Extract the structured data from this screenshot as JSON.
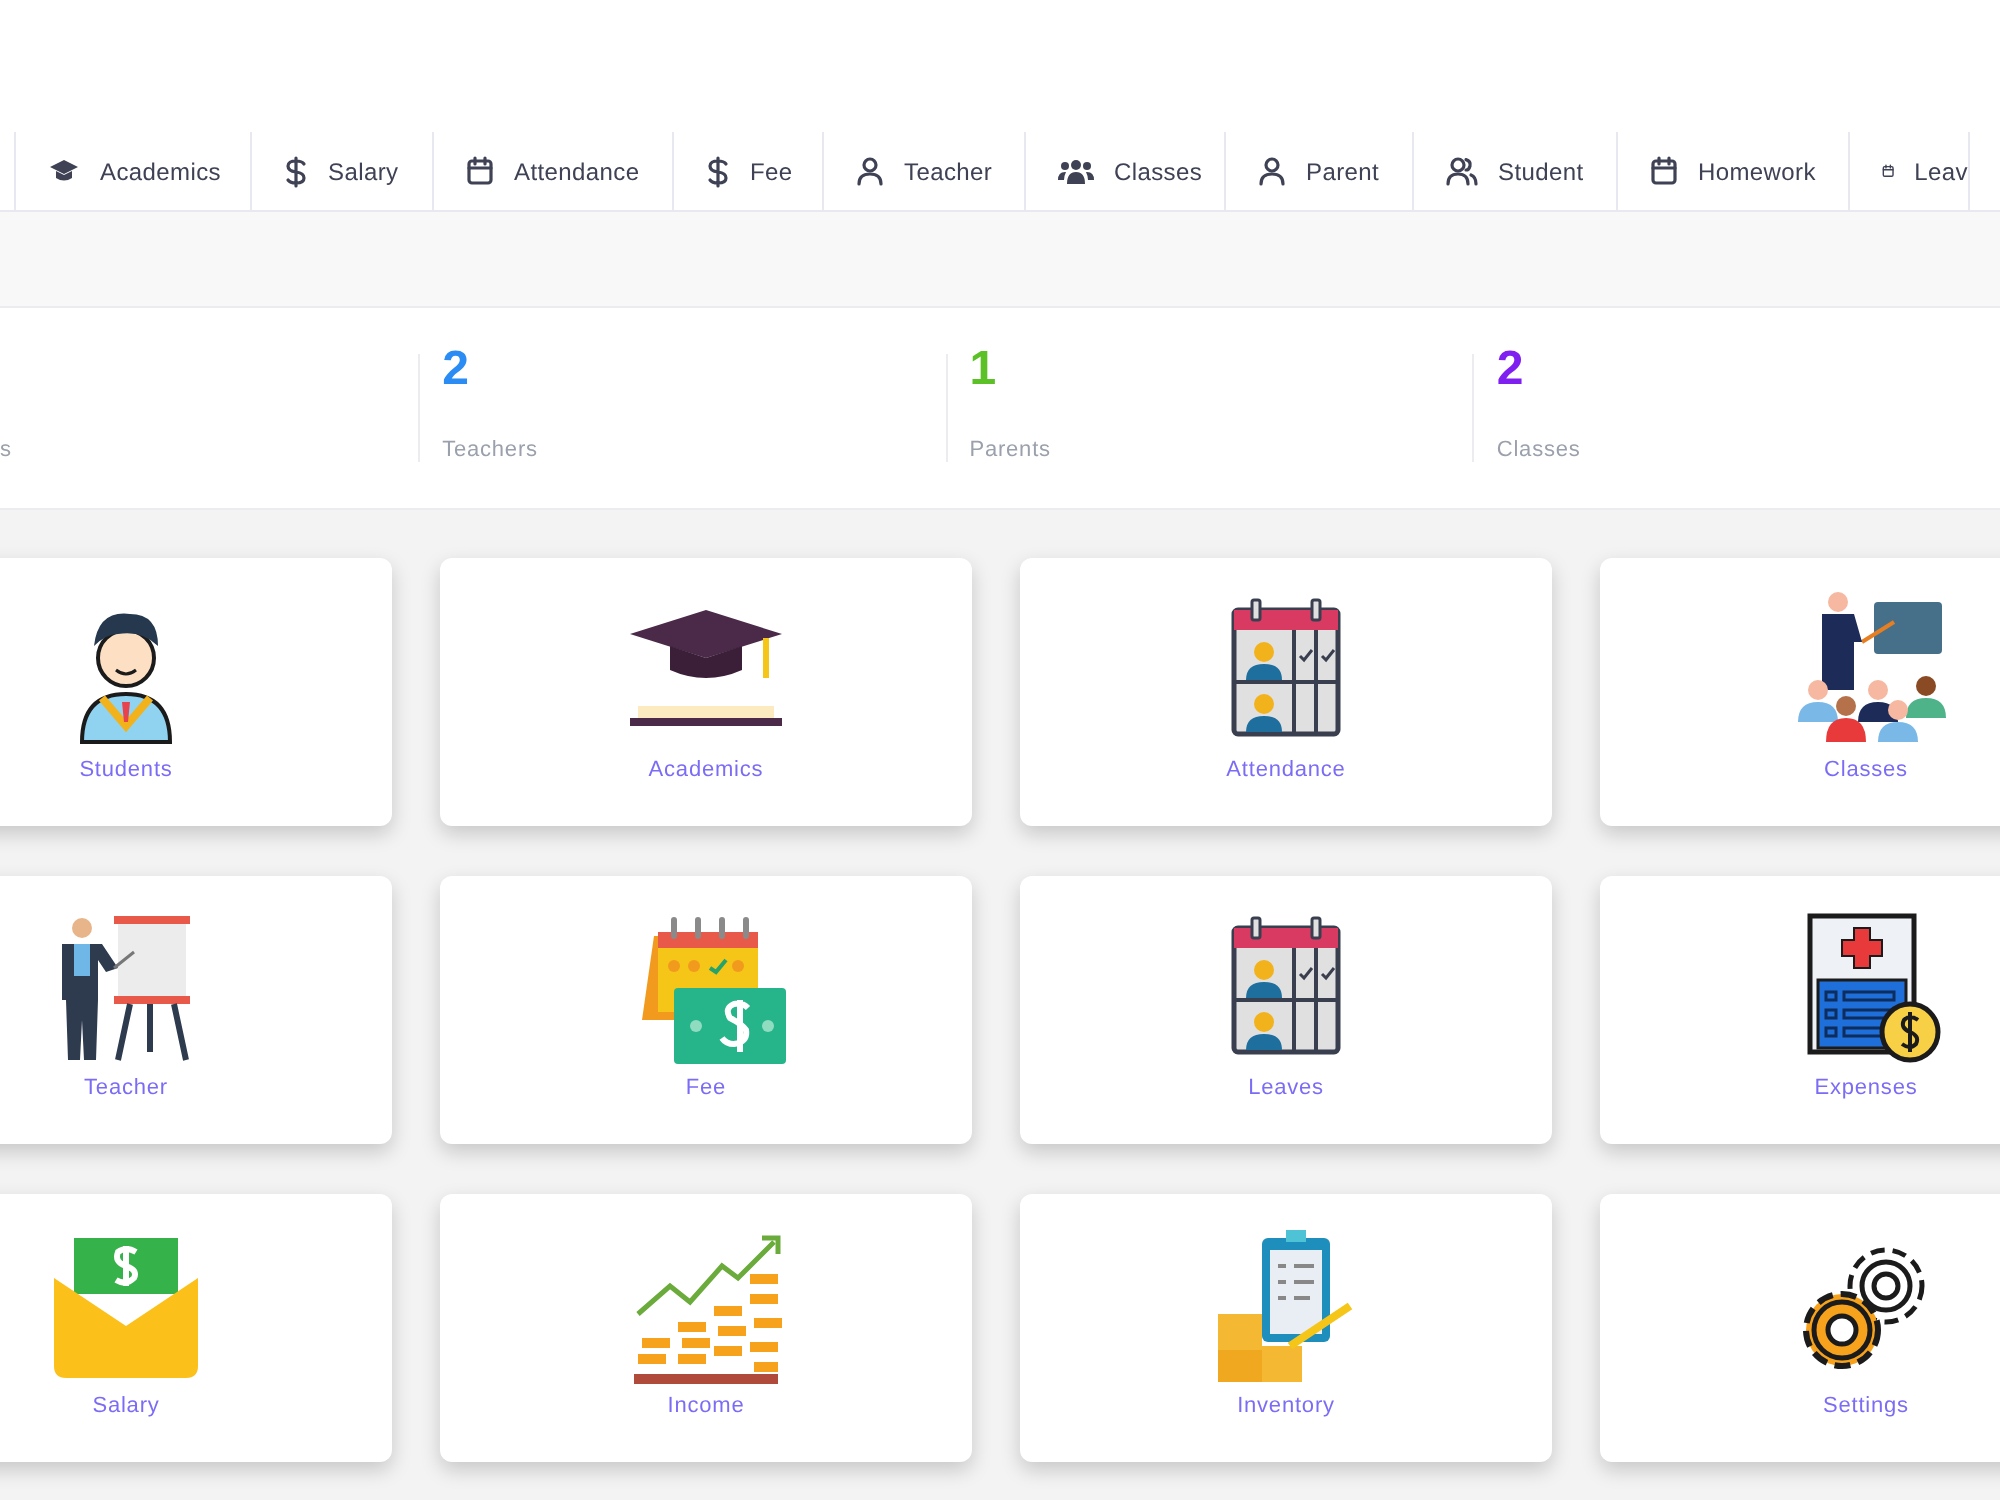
{
  "nav_tabs": [
    {
      "label": "Academics"
    },
    {
      "label": "Salary"
    },
    {
      "label": "Attendance"
    },
    {
      "label": "Fee"
    },
    {
      "label": "Teacher"
    },
    {
      "label": "Classes"
    },
    {
      "label": "Parent"
    },
    {
      "label": "Student"
    },
    {
      "label": "Homework"
    },
    {
      "label": "Leav"
    }
  ],
  "stats": [
    {
      "label": "s"
    },
    {
      "value": "2",
      "label": "Teachers",
      "color": "#2b8cf3"
    },
    {
      "value": "1",
      "label": "Parents",
      "color": "#5cc127"
    },
    {
      "value": "2",
      "label": "Classes",
      "color": "#7f1ff0"
    }
  ],
  "cards": [
    {
      "label": "Students"
    },
    {
      "label": "Academics"
    },
    {
      "label": "Attendance"
    },
    {
      "label": "Classes"
    },
    {
      "label": "Teacher"
    },
    {
      "label": "Fee"
    },
    {
      "label": "Leaves"
    },
    {
      "label": "Expenses"
    },
    {
      "label": "Salary"
    },
    {
      "label": "Income"
    },
    {
      "label": "Inventory"
    },
    {
      "label": "Settings"
    }
  ]
}
